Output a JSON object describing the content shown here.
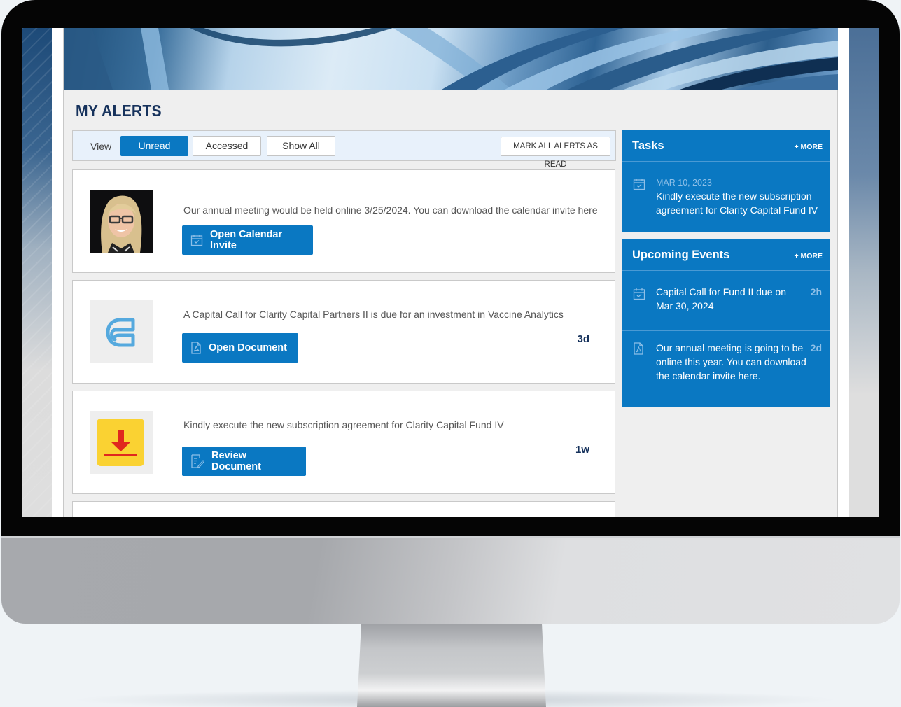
{
  "page": {
    "title": "MY ALERTS"
  },
  "filter": {
    "view_label": "View",
    "options": [
      {
        "label": "Unread",
        "active": true
      },
      {
        "label": "Accessed",
        "active": false
      },
      {
        "label": "Show All",
        "active": false
      }
    ],
    "mark_all_label": "MARK ALL ALERTS AS READ"
  },
  "alerts": [
    {
      "thumbnail": "person-photo",
      "message": "Our annual meeting would be held online 3/25/2024. You can download the calendar invite here",
      "action_label": "Open Calendar Invite",
      "action_icon": "calendar-check-icon",
      "age": ""
    },
    {
      "thumbnail": "company-logo",
      "message": "A Capital Call for Clarity Capital Partners II is due for an investment in Vaccine Analytics",
      "action_label": "Open Document",
      "action_icon": "pdf-document-icon",
      "age": "3d"
    },
    {
      "thumbnail": "download-icon",
      "message": "Kindly execute the new subscription agreement for Clarity Capital Fund IV",
      "action_label": "Review Document",
      "action_icon": "edit-document-icon",
      "age": "1w"
    }
  ],
  "tasks": {
    "title": "Tasks",
    "more_label": "+ MORE",
    "items": [
      {
        "icon": "calendar-check-icon",
        "date": "MAR 10, 2023",
        "text": "Kindly execute the new subscription agreement for Clarity Capital Fund IV"
      }
    ]
  },
  "events": {
    "title": "Upcoming Events",
    "more_label": "+ MORE",
    "items": [
      {
        "icon": "calendar-check-icon",
        "text": "Capital Call for Fund II due on Mar 30, 2024",
        "ago": "2h"
      },
      {
        "icon": "pdf-document-icon",
        "text": "Our annual meeting is going to be online this year. You can download the calendar invite here.",
        "ago": "2d"
      }
    ]
  },
  "colors": {
    "accent": "#0a78c2",
    "title": "#16325c",
    "filter_bg": "#e8f1fb",
    "muted_on_accent": "#8ec0e8"
  }
}
